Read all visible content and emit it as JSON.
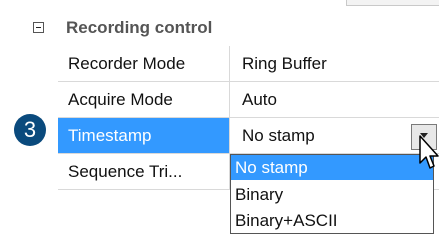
{
  "group": {
    "title": "Recording control"
  },
  "rows": [
    {
      "name": "Recorder Mode",
      "value": "Ring Buffer"
    },
    {
      "name": "Acquire Mode",
      "value": "Auto"
    },
    {
      "name": "Timestamp",
      "value": "No stamp"
    },
    {
      "name": "Sequence Tri...",
      "value": ""
    }
  ],
  "badge": {
    "number": "3"
  },
  "dropdown": {
    "options": [
      "No stamp",
      "Binary",
      "Binary+ASCII"
    ],
    "highlighted": "No stamp"
  },
  "colors": {
    "selection": "#3399ff",
    "badge": "#0a4a7d",
    "group_title": "#555555"
  },
  "icons": {
    "collapse": "minus-box-icon",
    "dropdown": "chevron-down-icon",
    "cursor": "mouse-pointer-icon"
  }
}
